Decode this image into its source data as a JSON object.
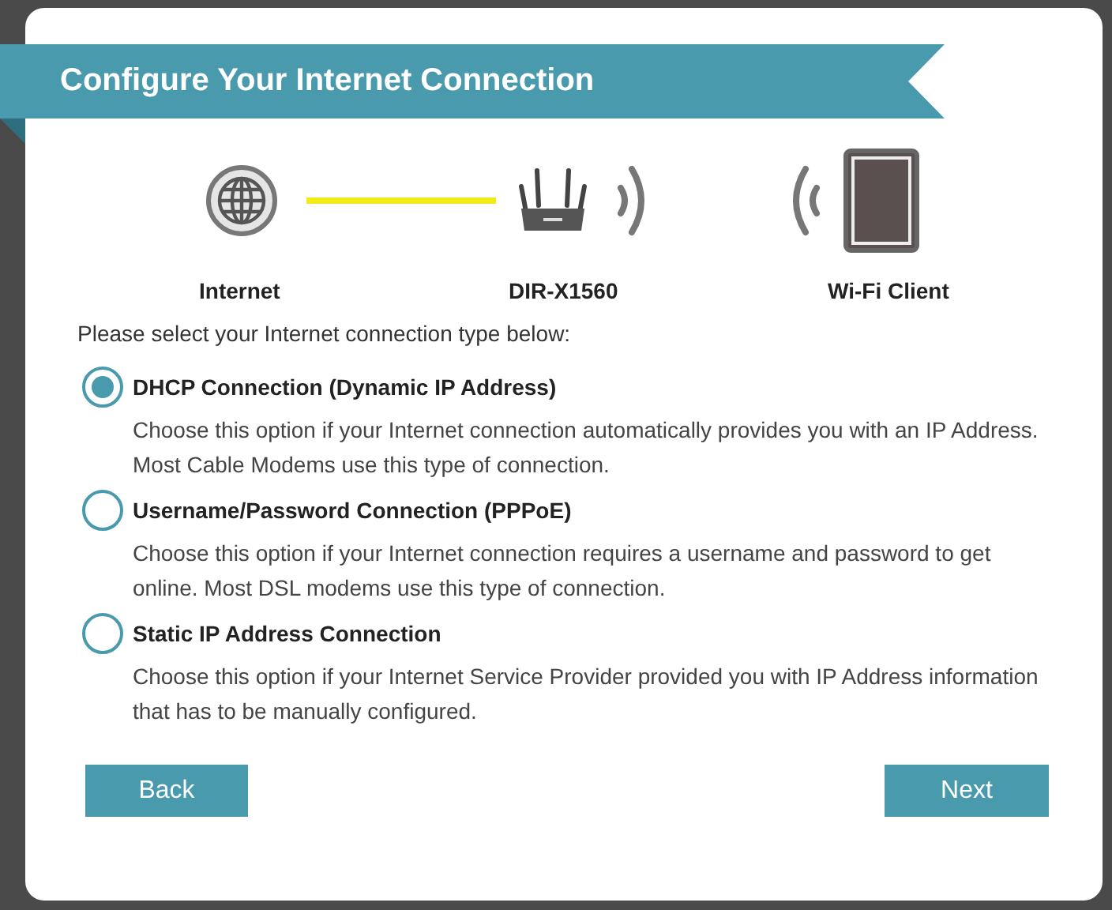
{
  "title": "Configure Your Internet Connection",
  "diagram": {
    "labels": [
      "Internet",
      "DIR-X1560",
      "Wi-Fi Client"
    ]
  },
  "instruction": "Please select your Internet connection type below:",
  "options": [
    {
      "label": "DHCP Connection (Dynamic IP Address)",
      "description": "Choose this option if your Internet connection automatically provides you with an IP Address. Most Cable Modems use this type of connection.",
      "selected": true
    },
    {
      "label": "Username/Password Connection (PPPoE)",
      "description": "Choose this option if your Internet connection requires a username and password to get online. Most DSL modems use this type of connection.",
      "selected": false
    },
    {
      "label": "Static IP Address Connection",
      "description": "Choose this option if your Internet Service Provider provided you with IP Address information that has to be manually configured.",
      "selected": false
    }
  ],
  "buttons": {
    "back": "Back",
    "next": "Next"
  }
}
